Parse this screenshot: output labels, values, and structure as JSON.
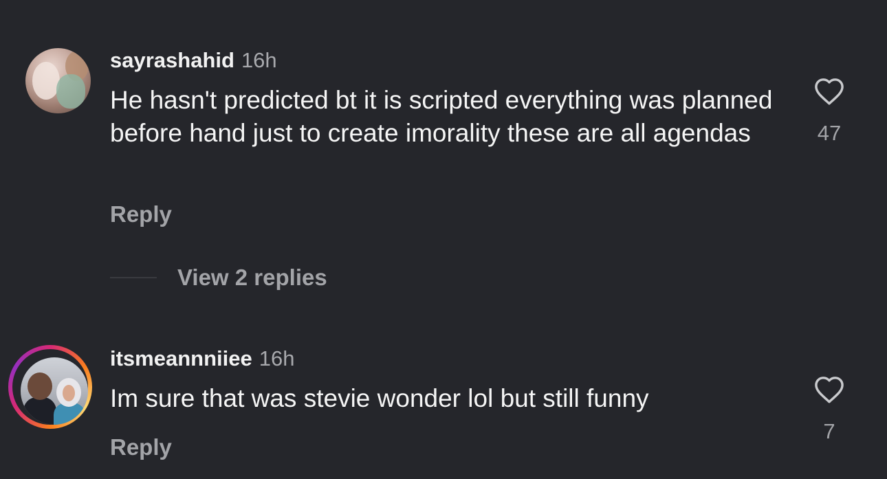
{
  "comments": [
    {
      "username": "sayrashahid",
      "time": "16h",
      "text": "He hasn't predicted bt it is scripted everything was planned before hand just to create imorality these are all agendas",
      "reply_label": "Reply",
      "view_replies": "View 2 replies",
      "like_count": "47",
      "icon": "heart-outline-icon"
    },
    {
      "username": "itsmeannniiee",
      "time": "16h",
      "text": "Im sure that was stevie wonder lol but still funny",
      "reply_label": "Reply",
      "like_count": "7",
      "icon": "heart-outline-icon",
      "has_story_ring": true
    }
  ],
  "colors": {
    "background": "#25262b",
    "text": "#f5f5f5",
    "secondary": "#a3a4a8",
    "story_ring": [
      "#d62976",
      "#fa7e1e",
      "#feda75",
      "#962fbf"
    ]
  }
}
